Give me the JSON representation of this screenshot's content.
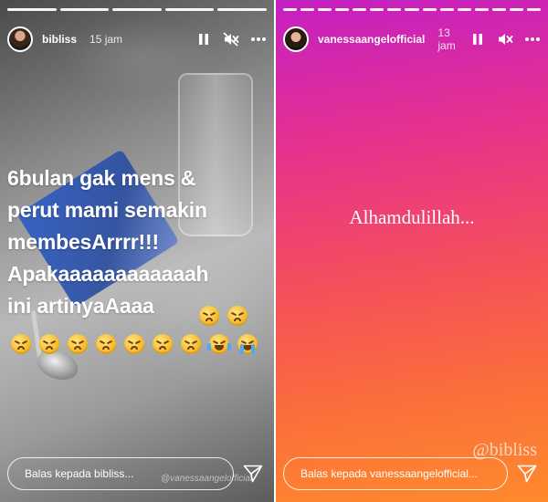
{
  "stories": [
    {
      "username": "bibliss",
      "time": "15 jam",
      "progress_total": 5,
      "progress_completed": 5,
      "text": "6bulan gak mens &\nperut mami semakin\nmembesArrrr!!!\nApakaaaaaaaaaaaah\nini artinyaAaaa",
      "emojis_line1": [
        "tired-face",
        "tired-face"
      ],
      "emojis_line2": [
        "tired-face",
        "tired-face",
        "tired-face",
        "tired-face",
        "tired-face",
        "tired-face",
        "tired-face",
        "joy-face",
        "crying-face"
      ],
      "watermark": "@vanessaangelofficial",
      "reply_placeholder": "Balas kepada bibliss..."
    },
    {
      "username": "vanessaangelofficial",
      "time": "13 jam",
      "progress_total": 15,
      "progress_completed": 15,
      "caption": "Alhamdulillah...",
      "watermark": "@bibliss",
      "reply_placeholder": "Balas kepada vanessaangelofficial..."
    }
  ],
  "icons": {
    "pause": "pause-icon",
    "mute": "mute-icon",
    "more": "more-icon",
    "send": "send-icon"
  }
}
